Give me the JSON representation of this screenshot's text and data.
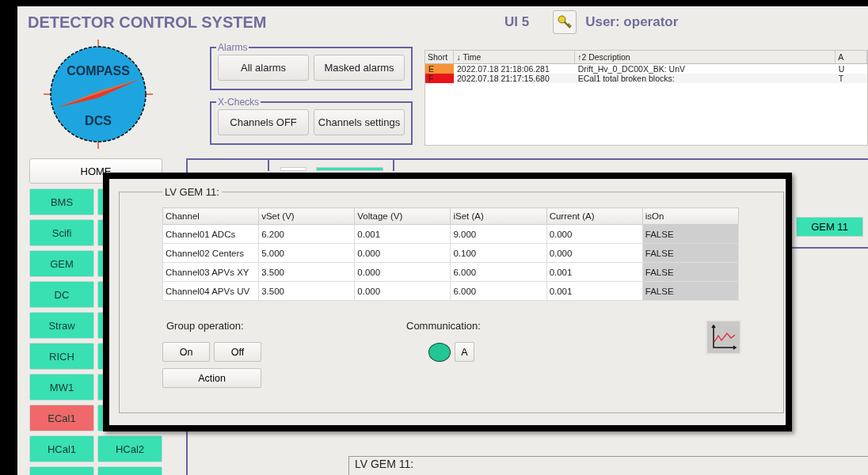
{
  "header": {
    "title": "DETECTOR CONTROL SYSTEM",
    "ui": "UI 5",
    "user": "User: operator"
  },
  "logo": {
    "top": "COMPASS",
    "bottom": "DCS"
  },
  "alarms_group": {
    "title": "Alarms",
    "buttons": [
      "All alarms",
      "Masked alarms"
    ]
  },
  "xchecks_group": {
    "title": "X-Checks",
    "buttons": [
      "Channels OFF",
      "Channels settings"
    ]
  },
  "alarm_table": {
    "columns": [
      "Short",
      "↓ Time",
      "↑2 Description",
      "A"
    ],
    "rows": [
      {
        "short": "E",
        "color": "#f79335",
        "time": "2022.07.18 21:18:06.281",
        "description": "Drift_Hv_0_DC00X_BK: UnV",
        "column_4": "U"
      },
      {
        "short": "F",
        "color": "#e8141a",
        "time": "2022.07.18 21:17:15.680",
        "description": "ECal1 total broken blocks:",
        "column_4": "T"
      }
    ]
  },
  "sidebar": {
    "home": "HOME",
    "rows": [
      {
        "left": {
          "label": "BMS",
          "color": "#38e0b2"
        },
        "right": {
          "color": "#38e0b2"
        }
      },
      {
        "left": {
          "label": "Scifi",
          "color": "#38e0b2"
        },
        "right": {
          "color": "#38e0b2"
        }
      },
      {
        "left": {
          "label": "GEM",
          "color": "#38e0b2"
        },
        "right": {
          "color": "#38e0b2"
        }
      },
      {
        "left": {
          "label": "DC",
          "color": "#38e0b2"
        },
        "right": {
          "color": "#38e0b2"
        }
      },
      {
        "left": {
          "label": "Straw",
          "color": "#38e0b2"
        },
        "right": {
          "color": "#38e0b2"
        }
      },
      {
        "left": {
          "label": "RICH",
          "color": "#38e0b2"
        },
        "right": {
          "color": "#38e0b2"
        }
      },
      {
        "left": {
          "label": "MW1",
          "color": "#38e0b2"
        },
        "right": {
          "color": "#38e0b2"
        }
      },
      {
        "left": {
          "label": "ECal1",
          "color": "#f06869"
        },
        "right": {
          "color": "#38e0b2"
        }
      },
      {
        "left": {
          "label": "HCal1",
          "color": "#38e0b2"
        },
        "right": {
          "label": "HCal2",
          "color": "#38e0b2"
        }
      },
      {
        "left": {
          "color": "#38e0b2"
        },
        "right": {
          "color": "#38e0b2"
        }
      }
    ]
  },
  "main": {
    "gem_button": "GEM 11",
    "lower_group": "LV GEM 11:"
  },
  "popup": {
    "title": "LV GEM 11:",
    "table": {
      "columns": [
        {
          "label": "Channel",
          "kind": "text"
        },
        {
          "label": "vSet (V)",
          "kind": "text"
        },
        {
          "label": "Voltage (V)",
          "kind": "text"
        },
        {
          "label": "iSet (A)",
          "kind": "text"
        },
        {
          "label": "Current (A)",
          "kind": "text"
        },
        {
          "label": "isOn",
          "kind": "bool"
        }
      ],
      "rows": [
        [
          "Channel01 ADCs",
          "6.200",
          "0.001",
          "9.000",
          "0.000",
          "FALSE"
        ],
        [
          "Channel02 Centers",
          "5.000",
          "0.000",
          "0.100",
          "0.000",
          "FALSE"
        ],
        [
          "Channel03 APVs XY",
          "3.500",
          "0.000",
          "6.000",
          "0.001",
          "FALSE"
        ],
        [
          "Channel04 APVs UV",
          "3.500",
          "0.000",
          "6.000",
          "0.001",
          "FALSE"
        ]
      ]
    },
    "group_operation": {
      "label": "Group operation:",
      "buttons": [
        "On",
        "Off"
      ],
      "action": "Action"
    },
    "communication": {
      "label": "Communication:",
      "connected": true,
      "button": "A"
    }
  }
}
